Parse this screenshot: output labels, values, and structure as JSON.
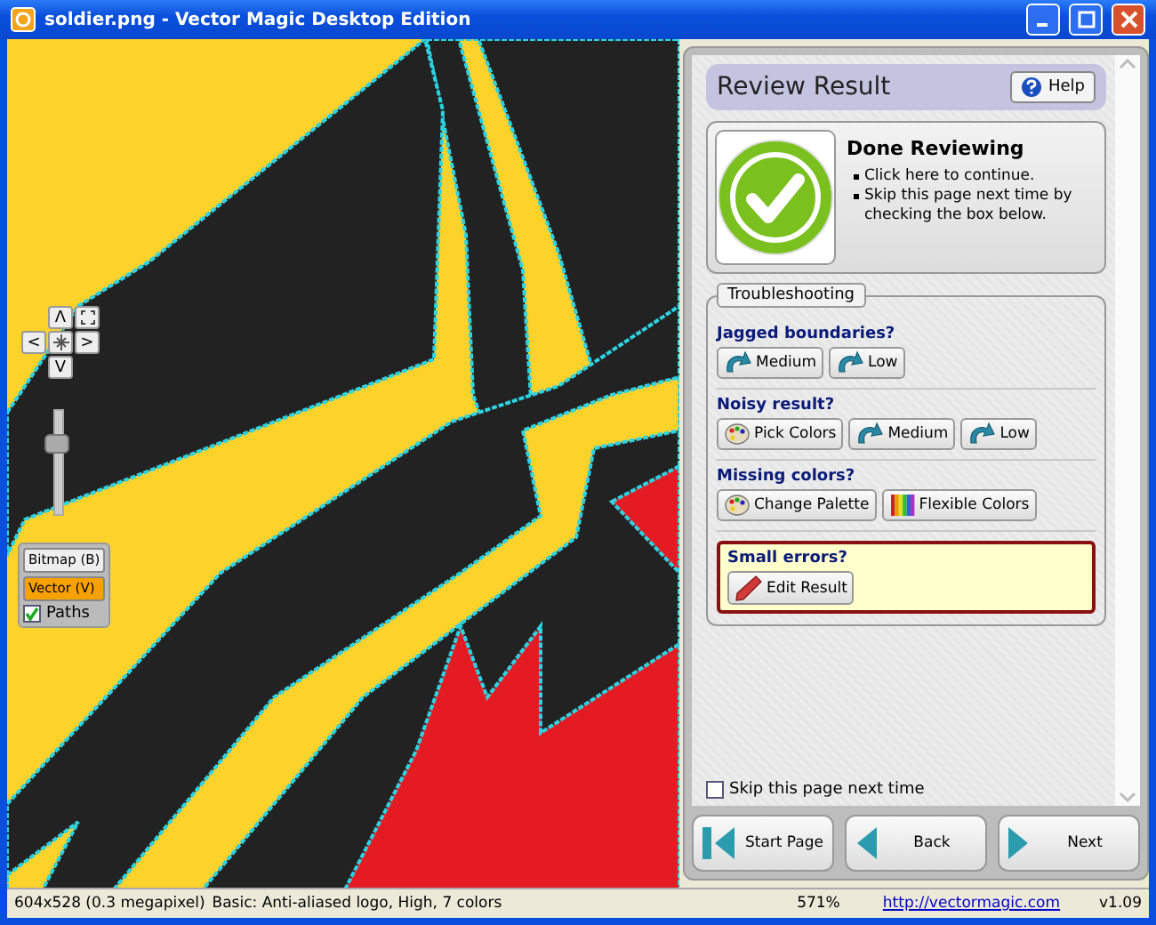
{
  "window": {
    "title": "soldier.png - Vector Magic Desktop Edition"
  },
  "pan_keys": {
    "up": "Λ",
    "left": "<",
    "right": ">",
    "down": "V"
  },
  "zoom_slider": {
    "level": 0.7
  },
  "view_modes": [
    {
      "label": "Bitmap (B)",
      "selected": false
    },
    {
      "label": "Vector (V)",
      "selected": true
    }
  ],
  "paths_toggle": {
    "label": "Paths",
    "checked": true
  },
  "panel": {
    "title": "Review Result",
    "help": "Help",
    "done": {
      "heading": "Done Reviewing",
      "bullets": [
        "Click here to continue.",
        "Skip this page next time by checking the box below."
      ]
    },
    "troubleshooting": {
      "legend": "Troubleshooting",
      "sections": [
        {
          "question": "Jagged boundaries?",
          "highlighted": false,
          "buttons": [
            {
              "label": "Medium",
              "kind": "redo"
            },
            {
              "label": "Low",
              "kind": "redo"
            }
          ]
        },
        {
          "question": "Noisy result?",
          "highlighted": false,
          "buttons": [
            {
              "label": "Pick Colors",
              "kind": "palette"
            },
            {
              "label": "Medium",
              "kind": "redo"
            },
            {
              "label": "Low",
              "kind": "redo"
            }
          ]
        },
        {
          "question": "Missing colors?",
          "highlighted": false,
          "buttons": [
            {
              "label": "Change Palette",
              "kind": "palette"
            },
            {
              "label": "Flexible Colors",
              "kind": "spectrum"
            }
          ]
        },
        {
          "question": "Small errors?",
          "highlighted": true,
          "buttons": [
            {
              "label": "Edit Result",
              "kind": "pencil"
            }
          ]
        }
      ]
    },
    "skip": {
      "label": "Skip this page next time",
      "checked": false
    },
    "nav_buttons": [
      {
        "label": "Start Page",
        "kind": "start"
      },
      {
        "label": "Back",
        "kind": "back"
      },
      {
        "label": "Next",
        "kind": "next"
      }
    ]
  },
  "status_bar": {
    "info": "604x528 (0.3 megapixel)",
    "settings": "Basic: Anti-aliased logo, High, 7 colors",
    "zoom": "571%",
    "link": "http://vectormagic.com",
    "version": "v1.09"
  }
}
